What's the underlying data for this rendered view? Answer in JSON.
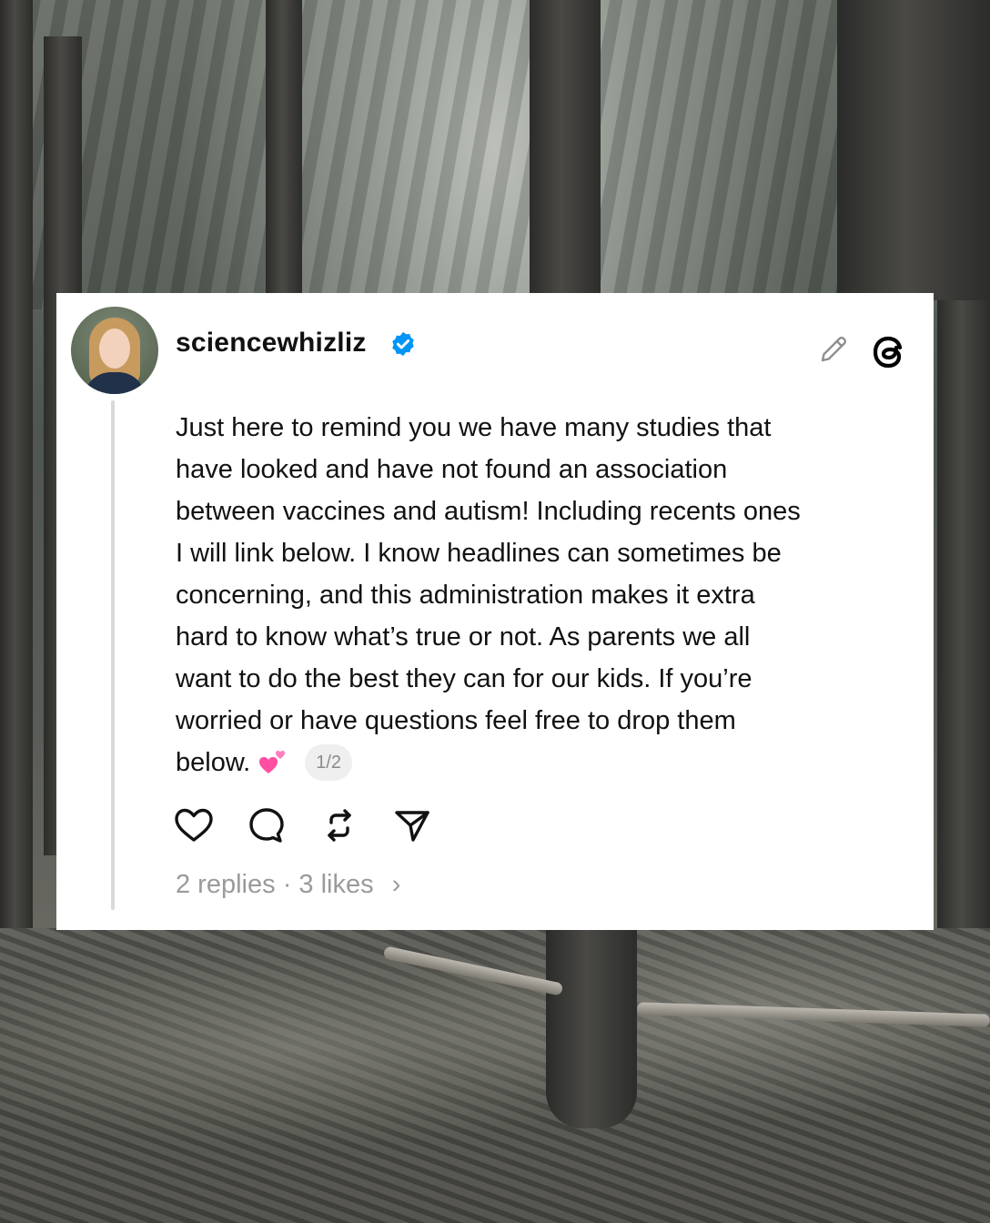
{
  "post": {
    "username": "sciencewhizliz",
    "verified_icon": "verified-badge-icon",
    "text_lines": [
      "Just here to remind you we have many studies that",
      "have looked and have not found an association",
      "between vaccines and autism! Including recents ones",
      "I will link below. I know headlines can sometimes be",
      "concerning, and this administration makes it extra",
      "hard to know what’s true or not. As parents we all",
      "want to do the best they can for our kids. If you’re",
      "worried or have questions feel free to drop them",
      "below."
    ],
    "emoji": "💕",
    "page_indicator": "1/2",
    "replies": "2 replies",
    "separator": "·",
    "likes": "3 likes",
    "chevron": "›"
  },
  "icons": {
    "edit": "pencil-icon",
    "brand": "threads-logo-icon",
    "like": "heart-icon",
    "reply": "comment-icon",
    "repost": "repost-icon",
    "share": "send-icon"
  },
  "colors": {
    "verified": "#0095f6",
    "text": "#111111",
    "muted": "#9a9a9a"
  }
}
